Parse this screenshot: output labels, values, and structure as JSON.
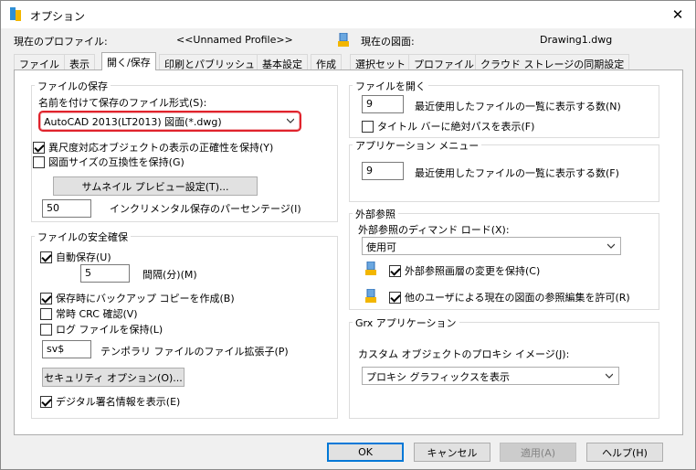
{
  "window": {
    "title": "オプション"
  },
  "header": {
    "profile_label": "現在のプロファイル:",
    "profile_value": "<<Unnamed Profile>>",
    "drawing_label": "現在の図面:",
    "drawing_value": "Drawing1.dwg"
  },
  "tabs": [
    {
      "label": "ファイル"
    },
    {
      "label": "表示"
    },
    {
      "label": "開く/保存"
    },
    {
      "label": "印刷とパブリッシュ"
    },
    {
      "label": "基本設定"
    },
    {
      "label": "作成"
    },
    {
      "label": "選択セット"
    },
    {
      "label": "プロファイル"
    },
    {
      "label": "クラウド ストレージの同期設定"
    }
  ],
  "active_tab": "開く/保存",
  "file_save": {
    "title": "ファイルの保存",
    "format_label": "名前を付けて保存のファイル形式(S):",
    "format_value": "AutoCAD 2013(LT2013) 図面(*.dwg)",
    "cb_annotative": {
      "label": "異尺度対応オブジェクトの表示の正確性を保持(Y)",
      "checked": true
    },
    "cb_drawing_size": {
      "label": "図面サイズの互換性を保持(G)",
      "checked": false
    },
    "thumbnail_button": "サムネイル プレビュー設定(T)...",
    "incremental_value": "50",
    "incremental_label": "インクリメンタル保存のパーセンテージ(I)"
  },
  "file_safety": {
    "title": "ファイルの安全確保",
    "cb_autosave": {
      "label": "自動保存(U)",
      "checked": true
    },
    "interval_value": "5",
    "interval_label": "間隔(分)(M)",
    "cb_backup": {
      "label": "保存時にバックアップ コピーを作成(B)",
      "checked": true
    },
    "cb_crc": {
      "label": "常時 CRC 確認(V)",
      "checked": false
    },
    "cb_log": {
      "label": "ログ ファイルを保持(L)",
      "checked": false
    },
    "temp_ext_value": "sv$",
    "temp_ext_label": "テンポラリ ファイルのファイル拡張子(P)",
    "security_button": "セキュリティ オプション(O)...",
    "cb_signature": {
      "label": "デジタル署名情報を表示(E)",
      "checked": true
    }
  },
  "file_open": {
    "title": "ファイルを開く",
    "recent_value": "9",
    "recent_label": "最近使用したファイルの一覧に表示する数(N)",
    "cb_fullpath": {
      "label": "タイトル バーに絶対パスを表示(F)",
      "checked": false
    }
  },
  "app_menu": {
    "title": "アプリケーション メニュー",
    "recent_value": "9",
    "recent_label": "最近使用したファイルの一覧に表示する数(F)"
  },
  "xref": {
    "title": "外部参照",
    "demand_label": "外部参照のディマンド ロード(X):",
    "demand_value": "使用可",
    "cb_layer_changes": {
      "label": "外部参照画層の変更を保持(C)",
      "checked": true
    },
    "cb_allow_edit": {
      "label": "他のユーザによる現在の図面の参照編集を許可(R)",
      "checked": true
    }
  },
  "grx": {
    "title": "Grx アプリケーション",
    "proxy_label": "カスタム オブジェクトのプロキシ イメージ(J):",
    "proxy_value": "プロキシ グラフィックスを表示"
  },
  "footer": {
    "ok": "OK",
    "cancel": "キャンセル",
    "apply": "適用(A)",
    "help": "ヘルプ(H)"
  },
  "colors": {
    "highlight_border": "#e0232c",
    "default_button_border": "#0078d7"
  }
}
